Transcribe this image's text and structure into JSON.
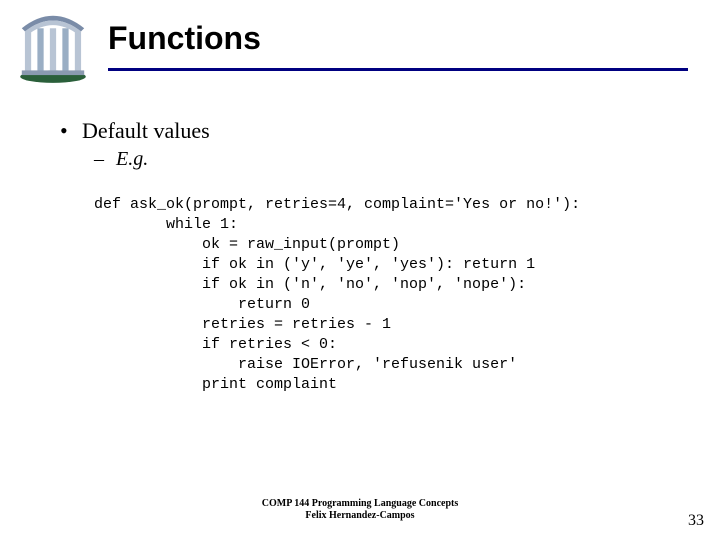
{
  "title": "Functions",
  "bullets": {
    "l1": "Default values",
    "l2": "E.g."
  },
  "code": "def ask_ok(prompt, retries=4, complaint='Yes or no!'):\n        while 1:\n            ok = raw_input(prompt)\n            if ok in ('y', 'ye', 'yes'): return 1\n            if ok in ('n', 'no', 'nop', 'nope'):\n                return 0\n            retries = retries - 1\n            if retries < 0:\n                raise IOError, 'refusenik user'\n            print complaint",
  "footer": {
    "line1": "COMP 144 Programming Language Concepts",
    "line2": "Felix Hernandez-Campos"
  },
  "pagenum": "33"
}
